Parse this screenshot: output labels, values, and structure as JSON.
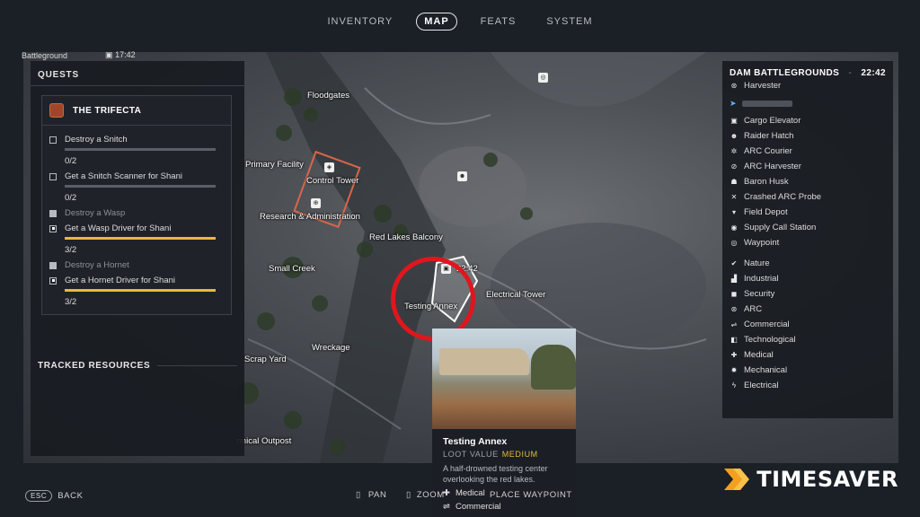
{
  "nav": {
    "tabs": [
      "INVENTORY",
      "MAP",
      "FEATS",
      "SYSTEM"
    ],
    "active_tab": "MAP"
  },
  "status": {
    "mode": "Battleground",
    "timer": "17:42"
  },
  "quests": {
    "header": "QUESTS",
    "quest_title": "THE TRIFECTA",
    "objectives": [
      {
        "label": "Destroy a Snitch",
        "state": "open",
        "progress": "0/2",
        "fill": 0
      },
      {
        "label": "Get a Snitch Scanner for Shani",
        "state": "open",
        "progress": "0/2",
        "fill": 0
      },
      {
        "label": "Destroy a Wasp",
        "state": "done"
      },
      {
        "label": "Get a Wasp Driver for Shani",
        "state": "active",
        "progress": "3/2",
        "fill": 1
      },
      {
        "label": "Destroy a Hornet",
        "state": "done"
      },
      {
        "label": "Get a Hornet Driver for Shani",
        "state": "active",
        "progress": "3/2",
        "fill": 1
      }
    ],
    "tracked_header": "TRACKED RESOURCES"
  },
  "legend": {
    "map_name": "DAM BATTLEGROUNDS",
    "time": "22:42",
    "top_item": "Harvester",
    "markers": [
      "Cargo Elevator",
      "Raider Hatch",
      "ARC Courier",
      "ARC Harvester",
      "Baron Husk",
      "Crashed ARC Probe",
      "Field Depot",
      "Supply Call Station",
      "Waypoint"
    ],
    "categories": [
      "Nature",
      "Industrial",
      "Security",
      "ARC",
      "Commercial",
      "Technological",
      "Medical",
      "Mechanical",
      "Electrical"
    ]
  },
  "map_labels": {
    "floodgates": "Floodgates",
    "primary_facility": "Primary Facility",
    "control_tower": "Control Tower",
    "research_admin": "Research & Administration",
    "red_lakes": "Red Lakes Balcony",
    "small_creek": "Small Creek",
    "electrical_tower": "Electrical Tower",
    "testing_annex": "Testing Annex",
    "wreckage": "Wreckage",
    "scrap_yard": "Scrap Yard",
    "chemical_outpost": "rmical Outpost",
    "marker_time": "22:42"
  },
  "tooltip": {
    "name": "Testing Annex",
    "loot_label": "LOOT VALUE",
    "loot_value": "MEDIUM",
    "description": "A half-drowned testing center overlooking the red lakes.",
    "tags": [
      "Medical",
      "Commercial"
    ]
  },
  "controls": {
    "back_key": "ESC",
    "back": "BACK",
    "pan": "PAN",
    "zoom": "ZOOM",
    "waypoint": "PLACE WAYPOINT"
  },
  "brand": "TIMESAVER",
  "colors": {
    "accent": "#e8b93a",
    "highlight_circle": "#e0161d",
    "brand_orange": "#f2a01f"
  }
}
